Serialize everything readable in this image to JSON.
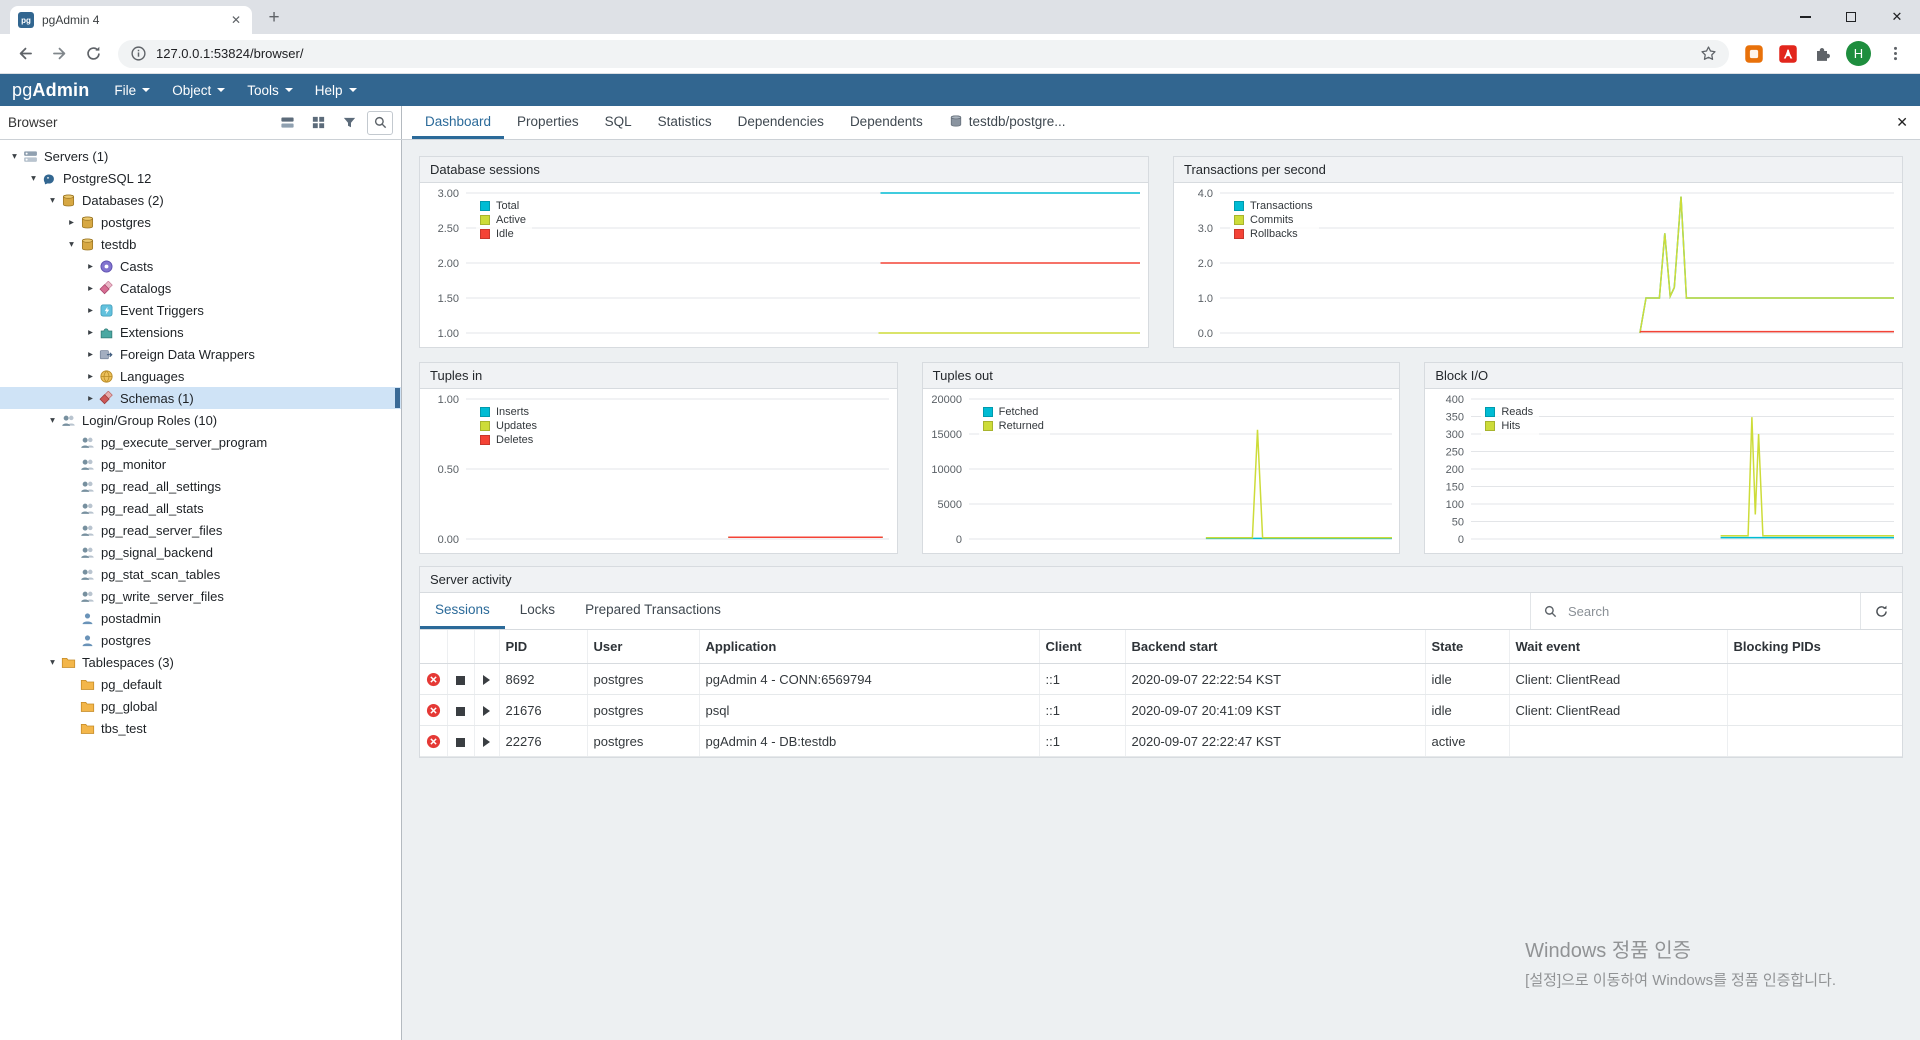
{
  "colors": {
    "accent": "#326690",
    "active_tab": "#2b6a99",
    "selection_bg": "#cfe3f6",
    "chart_blue": "#00BCD4",
    "chart_green": "#CDDC39",
    "chart_red": "#F44336"
  },
  "icons": {
    "chevron_open": "▾",
    "chevron_closed": "▸",
    "close": "✕",
    "plus": "+"
  },
  "browser_chrome": {
    "tab_title": "pgAdmin 4",
    "tab_favicon_text": "pg",
    "url": "127.0.0.1:53824/browser/",
    "profile_initial": "H"
  },
  "app_header": {
    "logo_pg": "pg",
    "logo_admin": "Admin",
    "menus": [
      {
        "label": "File"
      },
      {
        "label": "Object"
      },
      {
        "label": "Tools"
      },
      {
        "label": "Help"
      }
    ]
  },
  "sidebar": {
    "title": "Browser",
    "tree": [
      {
        "label": "Servers (1)",
        "level": 0,
        "icon": "server-group",
        "expand": "open"
      },
      {
        "label": "PostgreSQL 12",
        "level": 1,
        "icon": "server",
        "expand": "open"
      },
      {
        "label": "Databases (2)",
        "level": 2,
        "icon": "database",
        "expand": "open"
      },
      {
        "label": "postgres",
        "level": 3,
        "icon": "database",
        "expand": "closed"
      },
      {
        "label": "testdb",
        "level": 3,
        "icon": "database",
        "expand": "open"
      },
      {
        "label": "Casts",
        "level": 4,
        "icon": "cast",
        "expand": "closed"
      },
      {
        "label": "Catalogs",
        "level": 4,
        "icon": "catalog",
        "expand": "closed"
      },
      {
        "label": "Event Triggers",
        "level": 4,
        "icon": "event-trigger",
        "expand": "closed"
      },
      {
        "label": "Extensions",
        "level": 4,
        "icon": "extension",
        "expand": "closed"
      },
      {
        "label": "Foreign Data Wrappers",
        "level": 4,
        "icon": "fdw",
        "expand": "closed"
      },
      {
        "label": "Languages",
        "level": 4,
        "icon": "language",
        "expand": "closed"
      },
      {
        "label": "Schemas (1)",
        "level": 4,
        "icon": "schema",
        "expand": "closed",
        "selected": true
      },
      {
        "label": "Login/Group Roles (10)",
        "level": 2,
        "icon": "role-group",
        "expand": "open"
      },
      {
        "label": "pg_execute_server_program",
        "level": 3,
        "icon": "group-role"
      },
      {
        "label": "pg_monitor",
        "level": 3,
        "icon": "group-role"
      },
      {
        "label": "pg_read_all_settings",
        "level": 3,
        "icon": "group-role"
      },
      {
        "label": "pg_read_all_stats",
        "level": 3,
        "icon": "group-role"
      },
      {
        "label": "pg_read_server_files",
        "level": 3,
        "icon": "group-role"
      },
      {
        "label": "pg_signal_backend",
        "level": 3,
        "icon": "group-role"
      },
      {
        "label": "pg_stat_scan_tables",
        "level": 3,
        "icon": "group-role"
      },
      {
        "label": "pg_write_server_files",
        "level": 3,
        "icon": "group-role"
      },
      {
        "label": "postadmin",
        "level": 3,
        "icon": "user"
      },
      {
        "label": "postgres",
        "level": 3,
        "icon": "user"
      },
      {
        "label": "Tablespaces (3)",
        "level": 2,
        "icon": "folder",
        "expand": "open"
      },
      {
        "label": "pg_default",
        "level": 3,
        "icon": "folder"
      },
      {
        "label": "pg_global",
        "level": 3,
        "icon": "folder"
      },
      {
        "label": "tbs_test",
        "level": 3,
        "icon": "folder"
      }
    ]
  },
  "main_tabs": [
    {
      "label": "Dashboard",
      "active": true
    },
    {
      "label": "Properties"
    },
    {
      "label": "SQL"
    },
    {
      "label": "Statistics"
    },
    {
      "label": "Dependencies"
    },
    {
      "label": "Dependents"
    },
    {
      "label": "testdb/postgre...",
      "icon": "db-gray"
    }
  ],
  "chart_data": [
    {
      "id": "sessions",
      "type": "line",
      "title": "Database sessions",
      "ylim": [
        1,
        3
      ],
      "grid": true,
      "legend_position": "top-left",
      "yticks": [
        {
          "v": 3,
          "label": "3.00"
        },
        {
          "v": 2.5,
          "label": "2.50"
        },
        {
          "v": 2,
          "label": "2.00"
        },
        {
          "v": 1.5,
          "label": "1.50"
        },
        {
          "v": 1,
          "label": "1.00"
        }
      ],
      "series": [
        {
          "name": "Total",
          "color": "#00BCD4",
          "points": [
            [
              0.615,
              3.0
            ],
            [
              1,
              3.0
            ]
          ]
        },
        {
          "name": "Active",
          "color": "#CDDC39",
          "points": [
            [
              0.612,
              1.0
            ],
            [
              1,
              1.0
            ]
          ]
        },
        {
          "name": "Idle",
          "color": "#F44336",
          "points": [
            [
              0.615,
              2.0
            ],
            [
              1,
              2.0
            ]
          ]
        }
      ]
    },
    {
      "id": "tps",
      "type": "line",
      "title": "Transactions per second",
      "ylim": [
        0,
        4
      ],
      "grid": true,
      "legend_position": "top-left",
      "yticks": [
        {
          "v": 4,
          "label": "4.0"
        },
        {
          "v": 3,
          "label": "3.0"
        },
        {
          "v": 2,
          "label": "2.0"
        },
        {
          "v": 1,
          "label": "1.0"
        },
        {
          "v": 0,
          "label": "0.0"
        }
      ],
      "series": [
        {
          "name": "Transactions",
          "color": "#00BCD4",
          "points": [
            [
              0.623,
              0.0
            ],
            [
              0.632,
              1.0
            ],
            [
              0.652,
              1.0
            ],
            [
              0.66,
              2.85
            ],
            [
              0.668,
              1.05
            ],
            [
              0.674,
              1.3
            ],
            [
              0.684,
              3.9
            ],
            [
              0.692,
              1.0
            ],
            [
              1,
              1.0
            ]
          ]
        },
        {
          "name": "Commits",
          "color": "#CDDC39",
          "points": [
            [
              0.623,
              0.0
            ],
            [
              0.632,
              1.0
            ],
            [
              0.652,
              1.0
            ],
            [
              0.66,
              2.85
            ],
            [
              0.668,
              1.05
            ],
            [
              0.674,
              1.3
            ],
            [
              0.684,
              3.9
            ],
            [
              0.692,
              1.0
            ],
            [
              1,
              1.0
            ]
          ]
        },
        {
          "name": "Rollbacks",
          "color": "#F44336",
          "points": [
            [
              0.623,
              0.04
            ],
            [
              1,
              0.04
            ]
          ]
        }
      ]
    },
    {
      "id": "tuples-in",
      "type": "line",
      "title": "Tuples in",
      "ylim": [
        0,
        1
      ],
      "grid": true,
      "legend_position": "top-left",
      "yticks": [
        {
          "v": 1,
          "label": "1.00"
        },
        {
          "v": 0.5,
          "label": "0.50"
        },
        {
          "v": 0,
          "label": "0.00"
        }
      ],
      "series": [
        {
          "name": "Inserts",
          "color": "#00BCD4",
          "points": [
            [
              0.62,
              0.012
            ],
            [
              0.985,
              0.012
            ]
          ]
        },
        {
          "name": "Updates",
          "color": "#CDDC39",
          "points": [
            [
              0.62,
              0.012
            ],
            [
              0.985,
              0.012
            ]
          ]
        },
        {
          "name": "Deletes",
          "color": "#F44336",
          "points": [
            [
              0.62,
              0.012
            ],
            [
              0.985,
              0.012
            ]
          ]
        }
      ]
    },
    {
      "id": "tuples-out",
      "type": "line",
      "title": "Tuples out",
      "ylim": [
        0,
        20000
      ],
      "grid": true,
      "legend_position": "top-left",
      "yticks": [
        {
          "v": 20000,
          "label": "20000"
        },
        {
          "v": 15000,
          "label": "15000"
        },
        {
          "v": 10000,
          "label": "10000"
        },
        {
          "v": 5000,
          "label": "5000"
        },
        {
          "v": 0,
          "label": "0"
        }
      ],
      "series": [
        {
          "name": "Fetched",
          "color": "#00BCD4",
          "points": [
            [
              0.56,
              80
            ],
            [
              1,
              80
            ]
          ]
        },
        {
          "name": "Returned",
          "color": "#CDDC39",
          "points": [
            [
              0.56,
              180
            ],
            [
              0.67,
              180
            ],
            [
              0.682,
              15600
            ],
            [
              0.694,
              180
            ],
            [
              1,
              180
            ]
          ]
        }
      ]
    },
    {
      "id": "block-io",
      "type": "line",
      "title": "Block I/O",
      "ylim": [
        0,
        400
      ],
      "grid": true,
      "legend_position": "top-left",
      "yticks": [
        {
          "v": 400,
          "label": "400"
        },
        {
          "v": 350,
          "label": "350"
        },
        {
          "v": 300,
          "label": "300"
        },
        {
          "v": 250,
          "label": "250"
        },
        {
          "v": 200,
          "label": "200"
        },
        {
          "v": 150,
          "label": "150"
        },
        {
          "v": 100,
          "label": "100"
        },
        {
          "v": 50,
          "label": "50"
        },
        {
          "v": 0,
          "label": "0"
        }
      ],
      "series": [
        {
          "name": "Reads",
          "color": "#00BCD4",
          "points": [
            [
              0.59,
              4
            ],
            [
              1,
              4
            ]
          ]
        },
        {
          "name": "Hits",
          "color": "#CDDC39",
          "points": [
            [
              0.59,
              9
            ],
            [
              0.655,
              9
            ],
            [
              0.664,
              348
            ],
            [
              0.672,
              70
            ],
            [
              0.68,
              300
            ],
            [
              0.69,
              9
            ],
            [
              1,
              9
            ]
          ]
        }
      ]
    }
  ],
  "server_activity": {
    "title": "Server activity",
    "tabs": [
      {
        "label": "Sessions",
        "active": true
      },
      {
        "label": "Locks"
      },
      {
        "label": "Prepared Transactions"
      }
    ],
    "search_placeholder": "Search",
    "table": {
      "columns": [
        "",
        "",
        "",
        "PID",
        "User",
        "Application",
        "Client",
        "Backend start",
        "State",
        "Wait event",
        "Blocking PIDs"
      ],
      "rows": [
        {
          "pid": "8692",
          "user": "postgres",
          "application": "pgAdmin 4 - CONN:6569794",
          "client": "::1",
          "backend_start": "2020-09-07 22:22:54 KST",
          "state": "idle",
          "wait_event": "Client: ClientRead",
          "blocking_pids": ""
        },
        {
          "pid": "21676",
          "user": "postgres",
          "application": "psql",
          "client": "::1",
          "backend_start": "2020-09-07 20:41:09 KST",
          "state": "idle",
          "wait_event": "Client: ClientRead",
          "blocking_pids": ""
        },
        {
          "pid": "22276",
          "user": "postgres",
          "application": "pgAdmin 4 - DB:testdb",
          "client": "::1",
          "backend_start": "2020-09-07 22:22:47 KST",
          "state": "active",
          "wait_event": "",
          "blocking_pids": ""
        }
      ]
    }
  },
  "watermark": {
    "line1": "Windows 정품 인증",
    "line2": "[설정]으로 이동하여 Windows를 정품 인증합니다."
  }
}
